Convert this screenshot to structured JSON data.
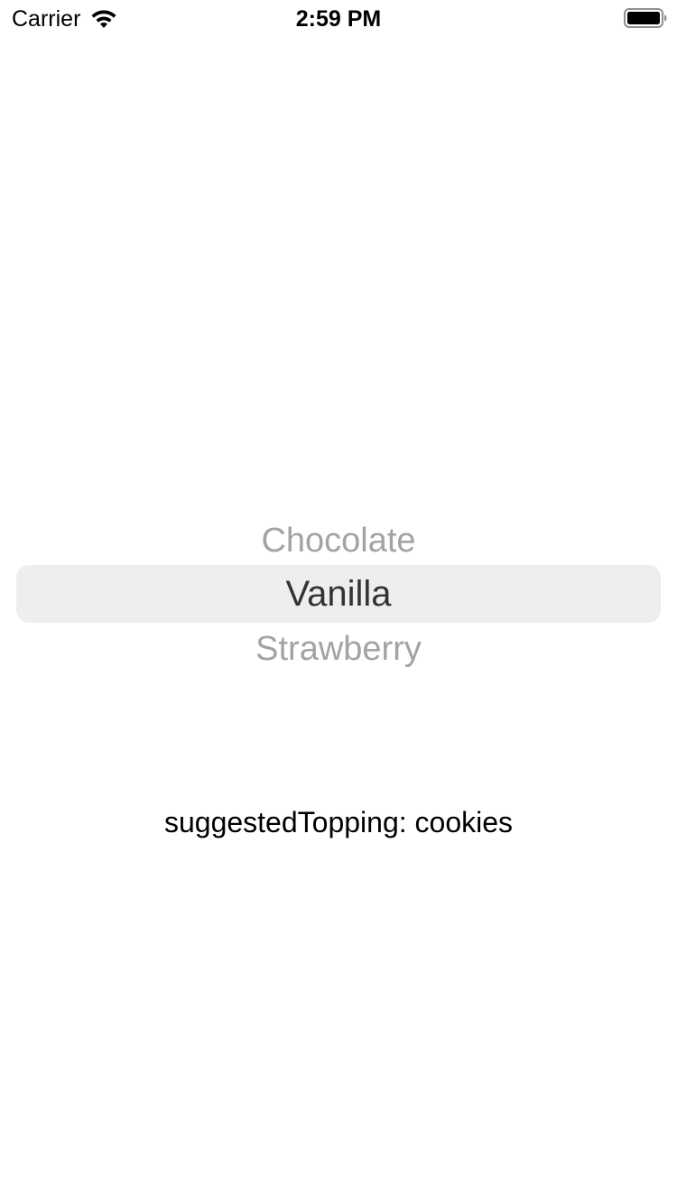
{
  "status_bar": {
    "carrier": "Carrier",
    "time": "2:59 PM",
    "icons": [
      "wifi-icon",
      "battery-icon"
    ]
  },
  "picker": {
    "rows": [
      "Chocolate",
      "Vanilla",
      "Strawberry"
    ],
    "selected": "Vanilla",
    "selection_color": "#eeeef0"
  },
  "label": {
    "text": "suggestedTopping: cookies"
  }
}
